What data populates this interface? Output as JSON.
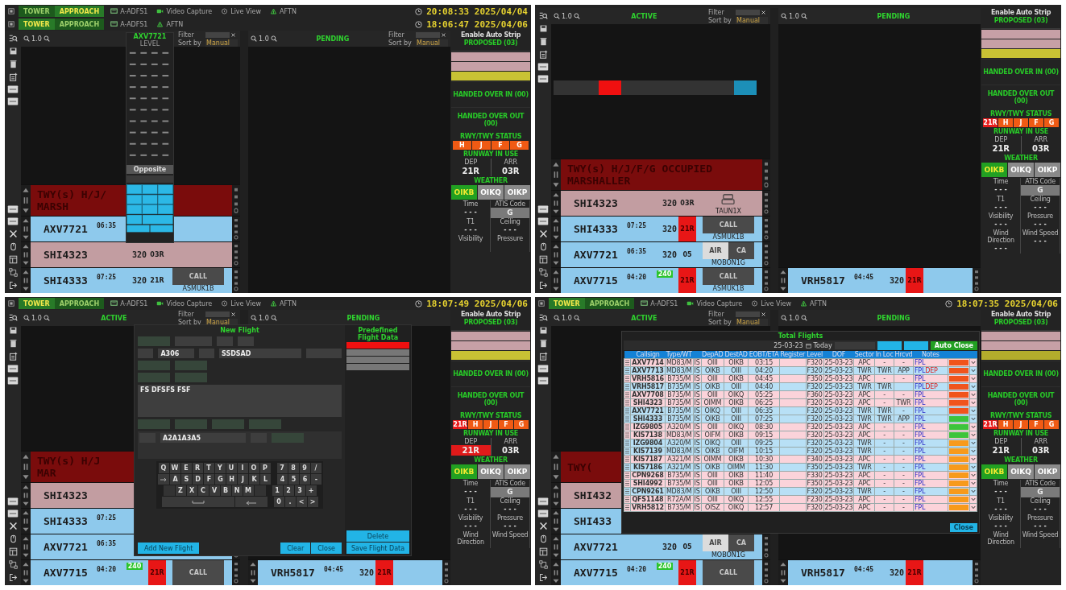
{
  "screens": [
    {
      "top_bars": [
        {
          "tabs": [
            {
              "label": "TOWER",
              "selected": false
            },
            {
              "label": "APPROACH",
              "selected": true
            }
          ],
          "links": [
            {
              "kind": "adfs",
              "label": "A-ADFS1"
            },
            {
              "kind": "video",
              "label": "Video Capture"
            },
            {
              "kind": "live",
              "label": "Live View"
            },
            {
              "kind": "aftn",
              "label": "AFTN"
            }
          ],
          "clock": "20:08:33 2025/04/04"
        },
        {
          "tabs": [
            {
              "label": "TOWER",
              "selected": true
            },
            {
              "label": "APPROACH",
              "selected": false
            }
          ],
          "links": [
            {
              "kind": "adfs",
              "label": "A-ADFS1"
            },
            {
              "kind": "aftn",
              "label": "AFTN"
            }
          ],
          "clock": "18:06:47 2025/04/06"
        }
      ],
      "active": {
        "zoom": "1.0",
        "filter": {
          "label": "Filter",
          "sort_label": "Sort by",
          "sort_value": "Manual"
        },
        "banner": [
          "TWY(s) H/J/",
          "MARSH"
        ],
        "strips": [
          {
            "color": "#8ec9ec",
            "callsign": "AXV7721",
            "time": "06:35"
          },
          {
            "color": "#c29da1",
            "callsign": "SHI4323",
            "level": "320",
            "runway": "03R",
            "runway_alert": false
          },
          {
            "color": "#8ec9ec",
            "callsign": "SHI4333",
            "time": "07:25",
            "level": "320",
            "runway": "21R",
            "runway_alert": false,
            "buttons": [
              {
                "kind": "dark",
                "label": "CALL"
              }
            ],
            "route": "ASMUK1B"
          }
        ]
      },
      "pending": {
        "title": "PENDING",
        "zoom": "1.0",
        "filter": {
          "label": "Filter",
          "sort_label": "Sort by",
          "sort_value": "Manual"
        }
      },
      "sidebar": {
        "auto_strip": "Enable Auto Strip",
        "proposed_title": "PROPOSED (03)",
        "proposed": [
          {
            "color": "#c7a0a6"
          },
          {
            "color": "#c7a0a6"
          },
          {
            "color": "#c9c234"
          }
        ],
        "handed_in": "HANDED OVER IN (00)",
        "handed_out": "HANDED OVER OUT (00)",
        "status_title": "RWY/TWY STATUS",
        "status_buttons": [
          {
            "label": "H",
            "color": "#f05a14"
          },
          {
            "label": "J",
            "color": "#f05a14"
          },
          {
            "label": "F",
            "color": "#f05a14"
          },
          {
            "label": "G",
            "color": "#f05a14"
          }
        ],
        "runway_title": "RUNWAY IN USE",
        "runways": [
          {
            "label": "DEP",
            "value": "21R",
            "alert": false
          },
          {
            "label": "ARR",
            "value": "03R",
            "alert": false
          }
        ],
        "weather_title": "WEATHER",
        "stations": [
          {
            "label": "OIKB",
            "selected": true
          },
          {
            "label": "OIKQ",
            "selected": false
          },
          {
            "label": "OIKP",
            "selected": false
          }
        ],
        "fields": [
          {
            "kind": "text",
            "label": "Time",
            "value": "- - -"
          },
          {
            "kind": "code",
            "label": "ATIS Code",
            "value": "G"
          },
          {
            "kind": "text",
            "label": "T1",
            "value": "- - -"
          },
          {
            "kind": "text",
            "label": "Ceiling",
            "value": "- - -"
          },
          {
            "label": "Visibility"
          },
          {
            "label": "Pressure"
          }
        ]
      },
      "overlay": {
        "kind": "level_picker",
        "callsign": "AXV7721",
        "title": "LEVEL",
        "opposite": "Opposite"
      }
    },
    {
      "active": {
        "title": "ACTIVE",
        "zoom": "1.0",
        "filter": {
          "label": "Filter",
          "sort_label": "Sort by",
          "sort_value": "Manual"
        },
        "banner": [
          "TWY(s) H/J/F/G OCCUPIED",
          "MARSHALLER"
        ],
        "strips": [
          {
            "color": "#c29da1",
            "callsign": "SHI4323",
            "level": "320",
            "runway": "03R",
            "runway_alert": false,
            "buttons": [
              {
                "kind": "icon"
              }
            ],
            "route": "TAUN1X"
          },
          {
            "color": "#8ec9ec",
            "callsign": "SHI4333",
            "time": "07:25",
            "level": "320",
            "runway": "21R",
            "runway_alert": true,
            "buttons": [
              {
                "kind": "dark",
                "label": "CALL"
              }
            ],
            "route": "ASMUK1B"
          },
          {
            "color": "#8ec9ec",
            "callsign": "AXV7721",
            "time": "06:35",
            "level": "320",
            "runway": "05",
            "runway_alert": false,
            "buttons": [
              {
                "kind": "light",
                "label": "AIR"
              },
              {
                "kind": "dark",
                "label": "CA"
              }
            ],
            "route": "MOBON1G"
          },
          {
            "color": "#8ec9ec",
            "callsign": "AXV7715",
            "time": "04:20",
            "cleared": "240",
            "runway": "21R",
            "runway_alert": true,
            "buttons": [
              {
                "kind": "dark",
                "label": "CALL"
              }
            ],
            "route": "ASMUK1B"
          }
        ]
      },
      "pending": {
        "title": "PENDING",
        "zoom": "1.0",
        "strips": [
          {
            "color": "#8ec9ec",
            "callsign": "VRH5817",
            "time": "04:45",
            "level": "320",
            "runway": "21R",
            "runway_alert": true
          }
        ]
      },
      "sidebar": {
        "auto_strip": "Enable Auto Strip",
        "proposed_title": "PROPOSED (03)",
        "proposed": [
          {
            "color": "#c7a0a6"
          },
          {
            "color": "#c7a0a6"
          },
          {
            "color": "#c9c234"
          }
        ],
        "handed_in": "HANDED OVER IN (00)",
        "handed_out": "HANDED OVER OUT (00)",
        "status_title": "RWY/TWY STATUS",
        "status_buttons": [
          {
            "label": "21R",
            "color": "#e81c1c"
          },
          {
            "label": "H",
            "color": "#f05a14"
          },
          {
            "label": "J",
            "color": "#f05a14"
          },
          {
            "label": "F",
            "color": "#f05a14"
          },
          {
            "label": "G",
            "color": "#f05a14"
          }
        ],
        "runway_title": "RUNWAY IN USE",
        "runways": [
          {
            "label": "DEP",
            "value": "21R",
            "alert": false
          },
          {
            "label": "ARR",
            "value": "03R",
            "alert": false
          }
        ],
        "weather_title": "WEATHER",
        "stations": [
          {
            "label": "OIKB",
            "selected": true
          },
          {
            "label": "OIKQ",
            "selected": false
          },
          {
            "label": "OIKP",
            "selected": false
          }
        ],
        "fields": [
          {
            "kind": "text",
            "label": "Time",
            "value": "- - -"
          },
          {
            "kind": "code",
            "label": "ATIS Code",
            "value": "G"
          },
          {
            "kind": "text",
            "label": "T1",
            "value": "- - -"
          },
          {
            "kind": "text",
            "label": "Ceiling",
            "value": "- - -"
          },
          {
            "kind": "text",
            "label": "Visibility",
            "value": "- - -"
          },
          {
            "kind": "text",
            "label": "Pressure",
            "value": "- - -"
          },
          {
            "kind": "text",
            "label": "Wind Direction",
            "value": "- - -"
          },
          {
            "kind": "text",
            "label": "Wind Speed",
            "value": "- - -"
          }
        ]
      },
      "overlay": {
        "kind": "runway_selector",
        "buttons": [
          {
            "kind": "option",
            "selected": false
          },
          {
            "kind": "option",
            "selected": false
          },
          {
            "kind": "option",
            "selected": true
          },
          {
            "kind": "option",
            "selected": false
          },
          {
            "kind": "option",
            "selected": false
          },
          {
            "kind": "option",
            "selected": false
          },
          {
            "kind": "option",
            "selected": false
          },
          {
            "kind": "option",
            "selected": false
          },
          {
            "kind": "confirm",
            "selected": false
          }
        ]
      }
    },
    {
      "top_bars": [
        {
          "tabs": [
            {
              "label": "TOWER",
              "selected": true
            },
            {
              "label": "APPROACH",
              "selected": false
            }
          ],
          "links": [
            {
              "kind": "adfs",
              "label": "A-ADFS1"
            },
            {
              "kind": "video",
              "label": "Video Capture"
            },
            {
              "kind": "live",
              "label": "Live View"
            },
            {
              "kind": "aftn",
              "label": "AFTN"
            }
          ],
          "clock": "18:07:49 2025/04/06"
        }
      ],
      "active": {
        "title": "ACTIVE",
        "zoom": "1.0",
        "filter": {
          "label": "Filter",
          "sort_label": "Sort by",
          "sort_value": "Manual"
        },
        "banner": [
          "TWY(s) H/J",
          "MAR"
        ],
        "strips": [
          {
            "color": "#c29da1",
            "callsign": "SHI4323"
          },
          {
            "color": "#8ec9ec",
            "callsign": "SHI4333",
            "time": "07:25"
          },
          {
            "color": "#8ec9ec",
            "callsign": "AXV7721",
            "time": "06:35"
          },
          {
            "color": "#8ec9ec",
            "callsign": "AXV7715",
            "time": "04:20",
            "cleared": "240",
            "runway": "21R",
            "runway_alert": true,
            "buttons": [
              {
                "kind": "dark",
                "label": "CALL"
              }
            ]
          }
        ]
      },
      "pending": {
        "title": "PENDING",
        "zoom": "1.0",
        "strips": [
          {
            "color": "#8ec9ec",
            "callsign": "VRH5817",
            "time": "04:45",
            "level": "320",
            "runway": "21R",
            "runway_alert": true
          }
        ]
      },
      "sidebar": {
        "auto_strip": "Enable Auto Strip",
        "proposed_title": "PROPOSED (03)",
        "proposed": [
          {
            "color": "#c7a0a6"
          },
          {
            "color": "#c7a0a6"
          },
          {
            "color": "#c9c234"
          }
        ],
        "handed_in": "HANDED OVER IN (00)",
        "handed_out": "HANDED OVER OUT (00)",
        "status_title": "RWY/TWY STATUS",
        "status_buttons": [
          {
            "label": "21R",
            "color": "#e81c1c"
          },
          {
            "label": "H",
            "color": "#f05a14"
          },
          {
            "label": "J",
            "color": "#f05a14"
          },
          {
            "label": "F",
            "color": "#f05a14"
          },
          {
            "label": "G",
            "color": "#f05a14"
          }
        ],
        "runway_title": "RUNWAY IN USE",
        "runways": [
          {
            "label": "DEP",
            "value": "21R",
            "alert": true
          },
          {
            "label": "ARR",
            "value": "03R",
            "alert": false
          }
        ],
        "weather_title": "WEATHER",
        "stations": [
          {
            "label": "OIKB",
            "selected": true
          },
          {
            "label": "OIKQ",
            "selected": false
          },
          {
            "label": "OIKP",
            "selected": false
          }
        ],
        "fields": [
          {
            "kind": "text",
            "label": "Time",
            "value": "- - -"
          },
          {
            "kind": "code",
            "label": "ATIS Code",
            "value": "G"
          },
          {
            "kind": "text",
            "label": "T1",
            "value": "- - -"
          },
          {
            "kind": "text",
            "label": "Ceiling",
            "value": "- - -"
          },
          {
            "kind": "text",
            "label": "Visibility",
            "value": "- - -"
          },
          {
            "kind": "text",
            "label": "Pressure",
            "value": "- - -"
          },
          {
            "label": "Wind Direction"
          },
          {
            "label": "Wind Speed"
          }
        ]
      },
      "overlay": {
        "kind": "new_flight",
        "title": "New Flight",
        "field_rows": [
          [
            {
              "kind": "green"
            },
            {
              "kind": "plain"
            },
            {
              "kind": "select"
            },
            {
              "kind": "select"
            }
          ],
          [
            {
              "kind": "small"
            },
            {
              "kind": "plain",
              "value": "A306"
            },
            {
              "kind": "select"
            },
            {
              "kind": "wide",
              "value": "SSDSAD"
            },
            {
              "kind": "plain"
            }
          ],
          [
            {
              "kind": "green"
            },
            {
              "kind": "green"
            }
          ],
          [
            {
              "kind": "green"
            },
            {
              "kind": "green"
            }
          ]
        ],
        "route": "FS DFSFS FSF",
        "field_row_after": [
          {
            "kind": "green"
          },
          {
            "kind": "green"
          },
          {
            "kind": "green"
          },
          {
            "kind": "green"
          }
        ],
        "remarks": [
          {
            "kind": "small"
          },
          {
            "kind": "wide",
            "value": "A2A1A3A5"
          },
          {
            "kind": "small"
          },
          {
            "kind": "green"
          }
        ],
        "keyboard": [
          [
            {
              "label": "Q"
            },
            {
              "label": "W"
            },
            {
              "label": "E"
            },
            {
              "label": "R"
            },
            {
              "label": "T"
            },
            {
              "label": "Y"
            },
            {
              "label": "U"
            },
            {
              "label": "I"
            },
            {
              "label": "O"
            },
            {
              "label": "P"
            },
            {
              "kind": "gap"
            },
            {
              "label": "7"
            },
            {
              "label": "8"
            },
            {
              "label": "9"
            },
            {
              "label": "/"
            }
          ],
          [
            {
              "kind": "tab"
            },
            {
              "label": "A"
            },
            {
              "label": "S"
            },
            {
              "label": "D"
            },
            {
              "label": "F"
            },
            {
              "label": "G"
            },
            {
              "label": "H"
            },
            {
              "label": "J"
            },
            {
              "label": "K"
            },
            {
              "label": "L"
            },
            {
              "kind": "gap"
            },
            {
              "label": "4"
            },
            {
              "label": "5"
            },
            {
              "label": "6"
            },
            {
              "label": "-"
            }
          ],
          [
            {
              "kind": "blank"
            },
            {
              "label": "Z"
            },
            {
              "label": "X"
            },
            {
              "label": "C"
            },
            {
              "label": "V"
            },
            {
              "label": "B"
            },
            {
              "label": "N"
            },
            {
              "label": "M"
            },
            {
              "kind": "blank"
            },
            {
              "kind": "gap"
            },
            {
              "label": "1"
            },
            {
              "label": "2"
            },
            {
              "label": "3"
            },
            {
              "label": "+"
            }
          ],
          [
            {
              "kind": "space"
            },
            {
              "kind": "backspace"
            },
            {
              "kind": "gap"
            },
            {
              "label": "0"
            },
            {
              "label": "."
            },
            {
              "label": "<"
            },
            {
              "label": ">"
            }
          ]
        ],
        "predefined_title": "Predefined Flight Data",
        "predefined": [
          {
            "selected": true
          },
          {
            "selected": false
          },
          {
            "selected": false
          },
          {
            "selected": false
          }
        ],
        "buttons": [
          {
            "kind": "add",
            "label": "Add New Flight"
          },
          {
            "kind": "footer",
            "label": "Clear"
          },
          {
            "kind": "footer",
            "label": "Close"
          }
        ],
        "side_buttons": [
          {
            "label": "Delete"
          },
          {
            "label": "Save Flight Data"
          }
        ]
      }
    },
    {
      "top_bars": [
        {
          "tabs": [
            {
              "label": "TOWER",
              "selected": true
            },
            {
              "label": "APPROACH",
              "selected": false
            }
          ],
          "links": [
            {
              "kind": "adfs",
              "label": "A-ADFS1"
            },
            {
              "kind": "video",
              "label": "Video Capture"
            },
            {
              "kind": "live",
              "label": "Live View"
            },
            {
              "kind": "aftn",
              "label": "AFTN"
            }
          ],
          "clock": "18:07:35 2025/04/06"
        }
      ],
      "active": {
        "title": "ACTIVE",
        "zoom": "1.0",
        "filter": {
          "label": "Filter",
          "sort_label": "Sort by",
          "sort_value": "Manual"
        },
        "banner": [
          "TWY("
        ],
        "strips": [
          {
            "color": "#c29da1",
            "callsign": "SHI432"
          },
          {
            "color": "#8ec9ec",
            "callsign": "SHI433"
          },
          {
            "color": "#8ec9ec",
            "callsign": "AXV7721",
            "level": "320",
            "runway": "05",
            "runway_alert": false,
            "buttons": [
              {
                "kind": "light",
                "label": "AIR"
              },
              {
                "kind": "dark",
                "label": "CA"
              }
            ],
            "route": "MOBON1G"
          },
          {
            "color": "#8ec9ec",
            "callsign": "AXV7715",
            "time": "04:20",
            "cleared": "240",
            "runway": "21R",
            "runway_alert": true,
            "buttons": [
              {
                "kind": "dark",
                "label": "CALL"
              }
            ]
          }
        ]
      },
      "pending": {
        "title": "PENDING",
        "zoom": "1.0",
        "strips": [
          {
            "color": "#8ec9ec",
            "callsign": "VRH5817",
            "time": "04:45",
            "level": "320",
            "runway": "21R",
            "runway_alert": true
          }
        ]
      },
      "sidebar": {
        "auto_strip": "Enable Auto Strip",
        "proposed_title": "PROPOSED (03)",
        "proposed": [
          {
            "color": "#c7a0a6"
          },
          {
            "color": "#c7a0a6"
          },
          {
            "color": "#b3ad2c"
          }
        ],
        "handed_in": "HANDED OVER IN (00)",
        "handed_out": "HANDED OVER OUT (00)",
        "status_title": "RWY/TWY STATUS",
        "status_buttons": [
          {
            "label": "21R",
            "color": "#e81c1c"
          },
          {
            "label": "H",
            "color": "#f05a14"
          },
          {
            "label": "J",
            "color": "#f05a14"
          },
          {
            "label": "F",
            "color": "#f05a14"
          },
          {
            "label": "G",
            "color": "#f05a14"
          }
        ],
        "runway_title": "RUNWAY IN USE",
        "runways": [
          {
            "label": "DEP",
            "value": "21R",
            "alert": false
          },
          {
            "label": "ARR",
            "value": "03R",
            "alert": false
          }
        ],
        "weather_title": "WEATHER",
        "stations": [
          {
            "label": "OIKB",
            "selected": true
          },
          {
            "label": "OIKQ",
            "selected": false
          },
          {
            "label": "OIKP",
            "selected": false
          }
        ],
        "fields": [
          {
            "kind": "text",
            "label": "Time",
            "value": "- - -"
          },
          {
            "kind": "code",
            "label": "ATIS Code",
            "value": "G"
          },
          {
            "kind": "text",
            "label": "T1",
            "value": "- - -"
          },
          {
            "kind": "text",
            "label": "Ceiling",
            "value": "- - -"
          },
          {
            "kind": "text",
            "label": "Visibility",
            "value": "- - -"
          },
          {
            "kind": "text",
            "label": "Pressure",
            "value": "- - -"
          },
          {
            "label": "Wind Direction"
          },
          {
            "label": "Wind Speed"
          }
        ]
      },
      "overlay": {
        "kind": "total_flights",
        "title": "Total Flights",
        "date": "25-03-23",
        "today": "Today",
        "tools": [
          {
            "kind": "blue"
          },
          {
            "kind": "blue"
          },
          {
            "kind": "green",
            "label": "Auto Close"
          }
        ],
        "columns": [
          {
            "kind": "text",
            "label": "Callsign"
          },
          {
            "kind": "text",
            "label": "Type/WT"
          },
          {
            "kind": "blank"
          },
          {
            "kind": "text",
            "label": "DepAD"
          },
          {
            "kind": "text",
            "label": "DestAD"
          },
          {
            "kind": "text",
            "label": "EOBT/ETA"
          },
          {
            "kind": "text",
            "label": "Register"
          },
          {
            "kind": "text",
            "label": "Level"
          },
          {
            "kind": "text",
            "label": "DOF"
          },
          {
            "kind": "text",
            "label": "Sector"
          },
          {
            "kind": "text",
            "label": "In Loc"
          },
          {
            "kind": "text",
            "label": "Hrcvd"
          },
          {
            "kind": "text",
            "label": "Notes"
          }
        ],
        "rows": [
          {
            "color": "#fbd3da",
            "status": {
              "color": "#f0541c"
            },
            "callsign": "AXV7714",
            "type": "MD83/M",
            "rules": "IS",
            "dep": "OIII",
            "dest": "OIKB",
            "time": "03:15",
            "level": "F320",
            "dof": "25-03-23",
            "sector": "APC",
            "in_loc": "-",
            "hrcvd": "-",
            "notes": "FPL"
          },
          {
            "color": "#b8e0f6",
            "status": {
              "color": "#f0541c"
            },
            "callsign": "AXV7713",
            "type": "MD83/M",
            "rules": "IS",
            "dep": "OIKB",
            "dest": "OIII",
            "time": "04:20",
            "level": "F320",
            "dof": "25-03-23",
            "sector": "TWR",
            "in_loc": "TWR",
            "hrcvd": "APP",
            "notes": "FPL",
            "flag": "DEP"
          },
          {
            "color": "#fbd3da",
            "status": {
              "color": "#f0541c"
            },
            "callsign": "VRH5816",
            "type": "B735/M",
            "rules": "IS",
            "dep": "OIII",
            "dest": "OIKB",
            "time": "04:45",
            "level": "F350",
            "dof": "25-03-23",
            "sector": "APC",
            "in_loc": "-",
            "hrcvd": "-",
            "notes": "FPL"
          },
          {
            "color": "#b8e0f6",
            "status": {
              "color": "#f0541c"
            },
            "callsign": "VRH5817",
            "type": "B735/M",
            "rules": "IS",
            "dep": "OIKB",
            "dest": "OIII",
            "time": "04:40",
            "level": "F320",
            "dof": "25-03-23",
            "sector": "TWR",
            "in_loc": "TWR",
            "notes": "FPL",
            "flag": "DEP"
          },
          {
            "color": "#fbd3da",
            "status": {
              "color": "#f0541c"
            },
            "callsign": "AXV7708",
            "type": "B735/M",
            "rules": "IS",
            "dep": "OIII",
            "dest": "OIKQ",
            "time": "05:25",
            "level": "F360",
            "dof": "25-03-23",
            "sector": "APC",
            "in_loc": "-",
            "hrcvd": "-",
            "notes": "FPL"
          },
          {
            "color": "#fbd3da",
            "status": {
              "color": "#f0541c"
            },
            "callsign": "SHI4323",
            "type": "B735/M",
            "rules": "IS",
            "dep": "OIMM",
            "dest": "OIKB",
            "time": "06:25",
            "level": "F320",
            "dof": "25-03-23",
            "sector": "APC",
            "in_loc": "-",
            "hrcvd": "TWR",
            "notes": "FPL"
          },
          {
            "color": "#b8e0f6",
            "status": {
              "color": "#f0541c"
            },
            "callsign": "AXV7721",
            "type": "B735/M",
            "rules": "IS",
            "dep": "OIKQ",
            "dest": "OIII",
            "time": "06:35",
            "level": "F320",
            "dof": "25-03-23",
            "sector": "TWR",
            "in_loc": "TWR",
            "hrcvd": "-",
            "notes": "FPL"
          },
          {
            "color": "#b8e0f6",
            "status": {
              "color": "#3cc43c"
            },
            "callsign": "SHI4333",
            "type": "B735/M",
            "rules": "IS",
            "dep": "OIKB",
            "dest": "OIII",
            "time": "07:25",
            "level": "F320",
            "dof": "25-03-23",
            "sector": "TWR",
            "in_loc": "TWR",
            "hrcvd": "APP",
            "notes": "FPL"
          },
          {
            "color": "#fbd3da",
            "status": {
              "color": "#3cc43c"
            },
            "callsign": "IZG9805",
            "type": "A320/M",
            "rules": "IS",
            "dep": "OIII",
            "dest": "OIKQ",
            "time": "08:30",
            "level": "F320",
            "dof": "25-03-23",
            "sector": "APC",
            "in_loc": "-",
            "hrcvd": "-",
            "notes": "FPL"
          },
          {
            "color": "#fbd3da",
            "status": {
              "color": "#3cc43c"
            },
            "callsign": "KIS7138",
            "type": "MD83/M",
            "rules": "IS",
            "dep": "OIFM",
            "dest": "OIKB",
            "time": "09:15",
            "level": "F320",
            "dof": "25-03-23",
            "sector": "APC",
            "in_loc": "-",
            "hrcvd": "-",
            "notes": "FPL"
          },
          {
            "color": "#b8e0f6",
            "status": {
              "color": "#f79a1c"
            },
            "callsign": "IZG9804",
            "type": "A320/M",
            "rules": "IS",
            "dep": "OIKQ",
            "dest": "OIII",
            "time": "09:25",
            "level": "F320",
            "dof": "25-03-23",
            "sector": "TWR",
            "in_loc": "-",
            "hrcvd": "-",
            "notes": "FPL"
          },
          {
            "color": "#b8e0f6",
            "status": {
              "color": "#f79a1c"
            },
            "callsign": "KIS7139",
            "type": "MD83/M",
            "rules": "IS",
            "dep": "OIKB",
            "dest": "OIFM",
            "time": "10:15",
            "level": "F320",
            "dof": "25-03-23",
            "sector": "TWR",
            "in_loc": "-",
            "hrcvd": "-",
            "notes": "FPL"
          },
          {
            "color": "#fbd3da",
            "status": {
              "color": "#f79a1c"
            },
            "callsign": "KIS7187",
            "type": "A321/M",
            "rules": "IS",
            "dep": "OIMM",
            "dest": "OIKB",
            "time": "10:30",
            "level": "F340",
            "dof": "25-03-23",
            "sector": "APC",
            "in_loc": "-",
            "hrcvd": "-",
            "notes": "FPL"
          },
          {
            "color": "#b8e0f6",
            "status": {
              "color": "#f79a1c"
            },
            "callsign": "KIS7186",
            "type": "A321/M",
            "rules": "IS",
            "dep": "OIKB",
            "dest": "OIMM",
            "time": "11:30",
            "level": "F350",
            "dof": "25-03-23",
            "sector": "TWR",
            "in_loc": "-",
            "hrcvd": "-",
            "notes": "FPL"
          },
          {
            "color": "#fbd3da",
            "status": {
              "color": "#f79a1c"
            },
            "callsign": "CPN9268",
            "type": "B735/M",
            "rules": "IS",
            "dep": "OIII",
            "dest": "OIKB",
            "time": "11:40",
            "level": "F330",
            "dof": "25-03-23",
            "sector": "APC",
            "in_loc": "-",
            "hrcvd": "-",
            "notes": "FPL"
          },
          {
            "color": "#fbd3da",
            "status": {
              "color": "#f79a1c"
            },
            "callsign": "SHI4992",
            "type": "B735/M",
            "rules": "IS",
            "dep": "OIII",
            "dest": "OIKB",
            "time": "12:05",
            "level": "F350",
            "dof": "25-03-23",
            "sector": "APC",
            "in_loc": "-",
            "hrcvd": "-",
            "notes": "FPL"
          },
          {
            "color": "#b8e0f6",
            "status": {
              "color": "#f79a1c"
            },
            "callsign": "CPN9261",
            "type": "MD83/M",
            "rules": "IS",
            "dep": "OIKB",
            "dest": "OIII",
            "time": "12:50",
            "level": "F320",
            "dof": "25-03-23",
            "sector": "TWR",
            "in_loc": "-",
            "hrcvd": "-",
            "notes": "FPL"
          },
          {
            "color": "#fbd3da",
            "status": {
              "color": "#f79a1c"
            },
            "callsign": "QFS1148",
            "type": "R72A/M",
            "rules": "IS",
            "dep": "OIII",
            "dest": "OIKQ",
            "time": "12:55",
            "level": "F230",
            "dof": "25-03-23",
            "sector": "APC",
            "in_loc": "-",
            "hrcvd": "-",
            "notes": "FPL"
          },
          {
            "color": "#fbd3da",
            "status": {
              "color": "#f79a1c"
            },
            "callsign": "VRH5812",
            "type": "B735/M",
            "rules": "IS",
            "dep": "OISZ",
            "dest": "OIKQ",
            "time": "12:57",
            "level": "F320",
            "dof": "25-03-23",
            "sector": "APC",
            "in_loc": "-",
            "hrcvd": "-",
            "notes": "FPL"
          }
        ],
        "close": "Close"
      }
    }
  ]
}
